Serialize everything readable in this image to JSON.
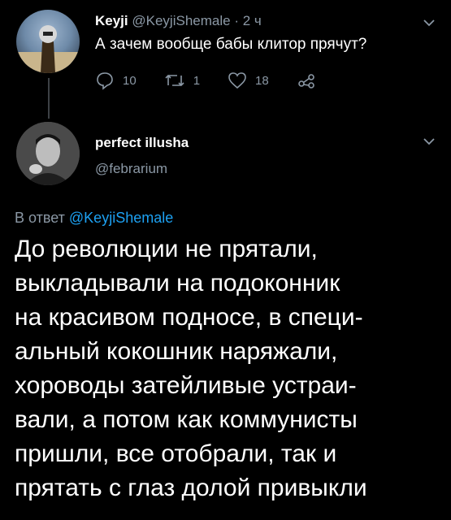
{
  "tweet1": {
    "author_name": "Keyji",
    "author_handle": "@KeyjiShemale",
    "separator": "·",
    "time": "2 ч",
    "text": "А зачем вообще бабы клитор прячут?",
    "replies": "10",
    "retweets": "1",
    "likes": "18"
  },
  "tweet2": {
    "author_name": "perfect illusha",
    "author_handle": "@febrarium",
    "reply_prefix": "В ответ",
    "reply_handle": "@KeyjiShemale",
    "lines": [
      "До революции не прятали,",
      "выкладывали на подоконник",
      "на красивом подносе, в специ-",
      "альный кокошник наряжали,",
      "хороводы затейливые устраи-",
      "вали, а потом как коммунисты",
      "пришли, все отобрали, так и",
      "прятать с глаз долой привыкли"
    ]
  },
  "icons": [
    "reply-icon",
    "retweet-icon",
    "like-icon",
    "share-icon",
    "chevron-down-icon"
  ],
  "colors": {
    "background": "#000000",
    "text": "#ffffff",
    "muted": "#8b98a5",
    "link": "#1da1f2",
    "thread_line": "#3d4145"
  }
}
